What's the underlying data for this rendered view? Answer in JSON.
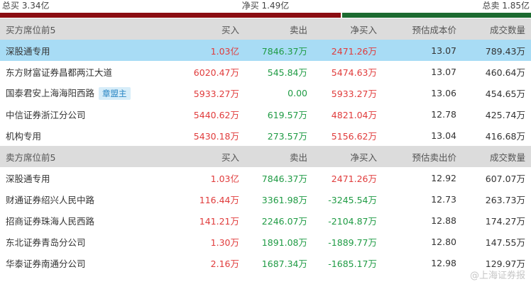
{
  "summary": {
    "total_buy": "总买 3.34亿",
    "net_buy": "净买 1.49亿",
    "total_sell": "总卖 1.85亿",
    "buy_share": 0.644,
    "colors": {
      "buy": "#8b0d12",
      "sell": "#1c6b30"
    }
  },
  "buy_section": {
    "header": [
      "买方席位前5",
      "买入",
      "卖出",
      "净买入",
      "预估成本价",
      "成交数量"
    ],
    "rows": [
      {
        "name": "深股通专用",
        "buy": "1.03亿",
        "sell": "7846.37万",
        "net": "2471.26万",
        "price": "13.07",
        "volume": "789.43万",
        "badge": "",
        "highlight": true
      },
      {
        "name": "东方财富证券昌都两江大道",
        "buy": "6020.47万",
        "sell": "545.84万",
        "net": "5474.63万",
        "price": "13.07",
        "volume": "460.64万",
        "badge": "",
        "highlight": false
      },
      {
        "name": "国泰君安上海海阳西路",
        "buy": "5933.27万",
        "sell": "0.00",
        "net": "5933.27万",
        "price": "13.06",
        "volume": "454.65万",
        "badge": "章盟主",
        "highlight": false
      },
      {
        "name": "中信证券浙江分公司",
        "buy": "5440.62万",
        "sell": "619.57万",
        "net": "4821.04万",
        "price": "12.78",
        "volume": "425.74万",
        "badge": "",
        "highlight": false
      },
      {
        "name": "机构专用",
        "buy": "5430.18万",
        "sell": "273.57万",
        "net": "5156.62万",
        "price": "13.04",
        "volume": "416.68万",
        "badge": "",
        "highlight": false
      }
    ]
  },
  "sell_section": {
    "header": [
      "卖方席位前5",
      "买入",
      "卖出",
      "净买入",
      "预估卖出价",
      "成交数量"
    ],
    "rows": [
      {
        "name": "深股通专用",
        "buy": "1.03亿",
        "sell": "7846.37万",
        "net": "2471.26万",
        "price": "12.92",
        "volume": "607.07万",
        "net_sign": "pos"
      },
      {
        "name": "财通证券绍兴人民中路",
        "buy": "116.44万",
        "sell": "3361.98万",
        "net": "-3245.54万",
        "price": "12.73",
        "volume": "263.73万",
        "net_sign": "neg"
      },
      {
        "name": "招商证券珠海人民西路",
        "buy": "141.21万",
        "sell": "2246.07万",
        "net": "-2104.87万",
        "price": "12.88",
        "volume": "174.27万",
        "net_sign": "neg"
      },
      {
        "name": "东北证券青岛分公司",
        "buy": "1.30万",
        "sell": "1891.08万",
        "net": "-1889.77万",
        "price": "12.80",
        "volume": "147.55万",
        "net_sign": "neg"
      },
      {
        "name": "华泰证券南通分公司",
        "buy": "2.16万",
        "sell": "1687.34万",
        "net": "-1685.17万",
        "price": "12.98",
        "volume": "129.97万",
        "net_sign": "neg"
      }
    ]
  },
  "watermark": "@上海证券报"
}
